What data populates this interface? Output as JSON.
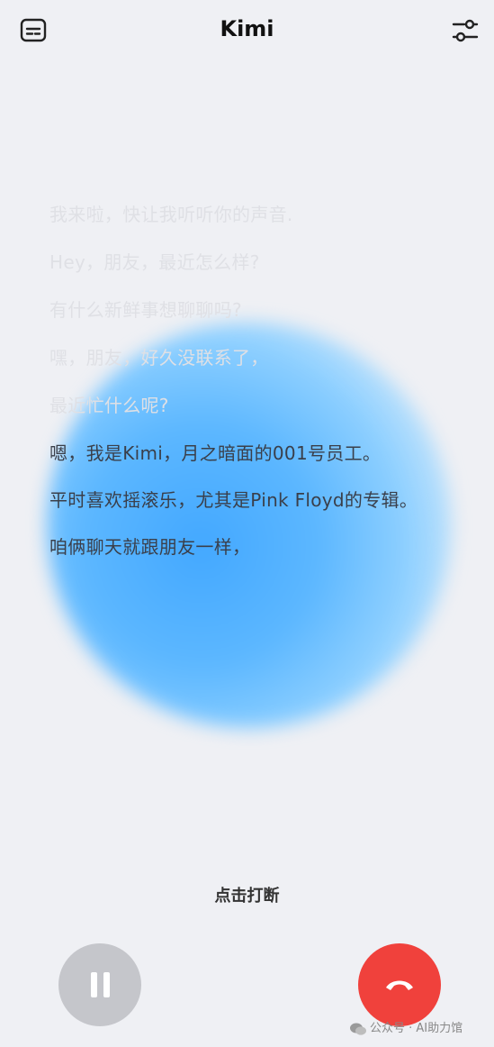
{
  "header": {
    "title": "Kimi",
    "subtitle_icon": "subtitles-icon",
    "settings_icon": "sliders-icon"
  },
  "transcript": {
    "past_lines": [
      "我来啦，快让我听听你的声音.",
      "Hey，朋友，最近怎么样?",
      "有什么新鲜事想聊聊吗?",
      "嘿，朋友，好久没联系了，",
      "最近忙什么呢?"
    ],
    "current_lines": [
      "嗯，我是Kimi，月之暗面的001号员工。",
      "平时喜欢摇滚乐，尤其是Pink Floyd的专辑。",
      "咱俩聊天就跟朋友一样，"
    ]
  },
  "controls": {
    "interrupt_label": "点击打断",
    "pause_icon": "pause-icon",
    "hangup_icon": "hang-up-icon"
  },
  "watermark": {
    "text": "公众号 · AI助力馆"
  },
  "colors": {
    "background": "#eff0f4",
    "blob": "#43a8ff",
    "hangup": "#f0413c",
    "pause": "#c5c6cb"
  }
}
